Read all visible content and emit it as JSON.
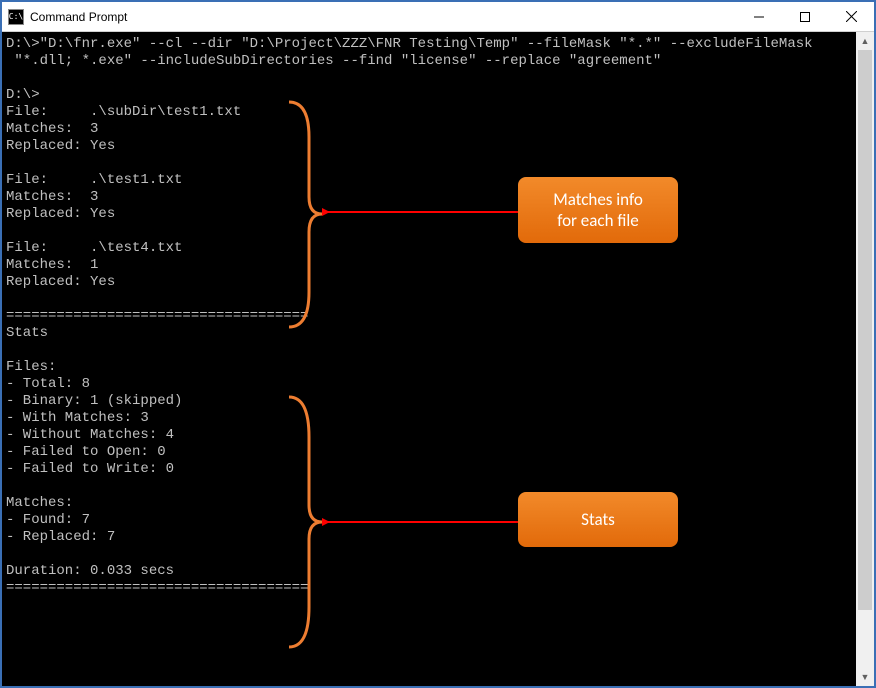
{
  "window": {
    "title": "Command Prompt",
    "icon_label": "C:\\"
  },
  "console": {
    "command_line1": "D:\\>\"D:\\fnr.exe\" --cl --dir \"D:\\Project\\ZZZ\\FNR Testing\\Temp\" --fileMask \"*.*\" --excludeFileMask",
    "command_line2": " \"*.dll; *.exe\" --includeSubDirectories --find \"license\" --replace \"agreement\"",
    "prompt": "D:\\>",
    "files": [
      {
        "file": "File:     .\\subDir\\test1.txt",
        "matches": "Matches:  3",
        "replaced": "Replaced: Yes"
      },
      {
        "file": "File:     .\\test1.txt",
        "matches": "Matches:  3",
        "replaced": "Replaced: Yes"
      },
      {
        "file": "File:     .\\test4.txt",
        "matches": "Matches:  1",
        "replaced": "Replaced: Yes"
      }
    ],
    "separator": "====================================",
    "stats_header": "Stats",
    "stats_files_header": "Files:",
    "stats_files": [
      "- Total: 8",
      "- Binary: 1 (skipped)",
      "- With Matches: 3",
      "- Without Matches: 4",
      "- Failed to Open: 0",
      "- Failed to Write: 0"
    ],
    "stats_matches_header": "Matches:",
    "stats_matches": [
      "- Found: 7",
      "- Replaced: 7"
    ],
    "duration": "Duration: 0.033 secs"
  },
  "annotations": {
    "matches_info": "Matches info\nfor each file",
    "stats": "Stats",
    "brace_color": "#ed7d31",
    "arrow_color": "#ff0000"
  }
}
